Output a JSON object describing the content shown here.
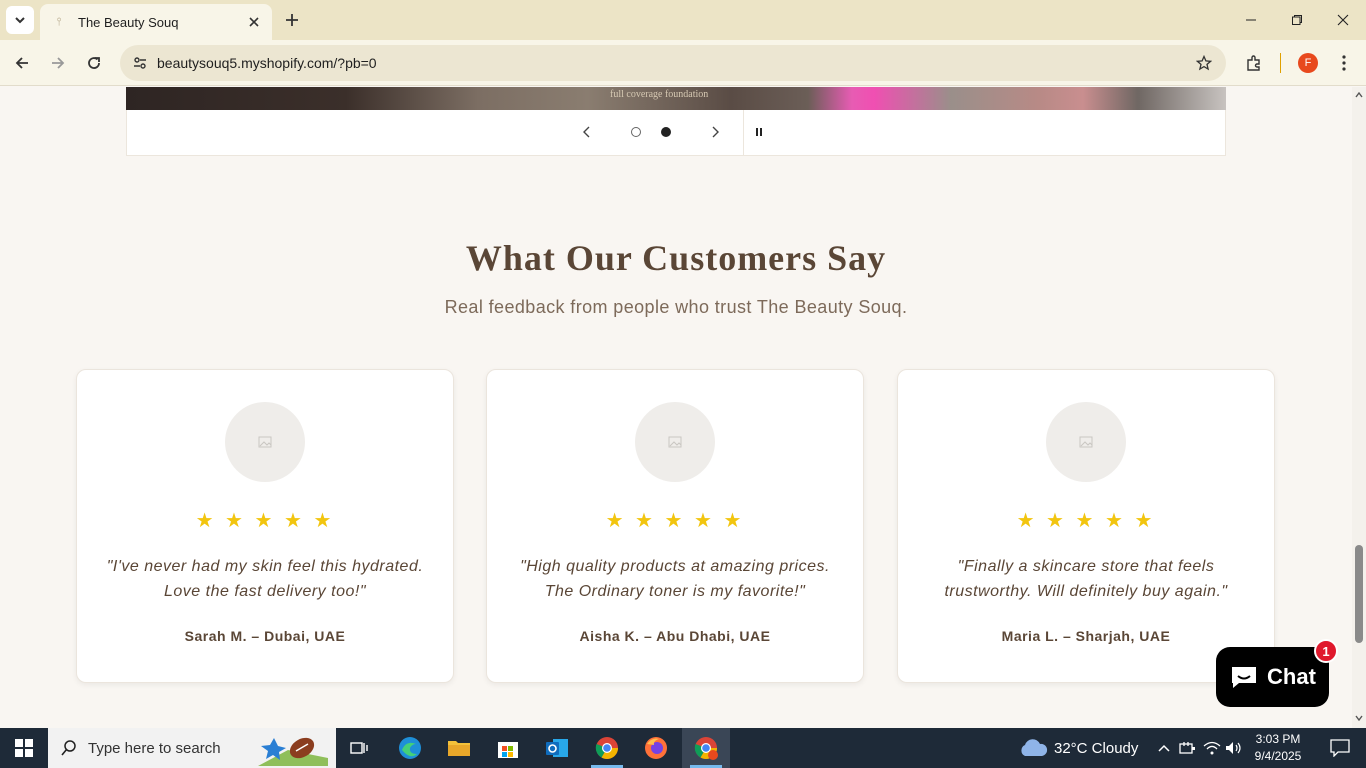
{
  "browser": {
    "tab_title": "The Beauty Souq",
    "url": "beautysouq5.myshopify.com/?pb=0",
    "profile_initial": "F",
    "icons": [
      "tab-search-icon",
      "favicon-icon",
      "close-tab-icon",
      "new-tab-icon",
      "minimize-icon",
      "restore-icon",
      "window-close-icon",
      "back-icon",
      "forward-icon",
      "reload-icon",
      "site-info-icon",
      "bookmark-star-icon",
      "extensions-icon",
      "menu-kebab-icon"
    ]
  },
  "slideshow": {
    "caption": "full coverage foundation",
    "dots": [
      "slide-1",
      "slide-2"
    ],
    "active_slide": 2
  },
  "testimonials": {
    "title": "What Our Customers Say",
    "subtitle": "Real feedback from people who trust The Beauty Souq.",
    "star_color": "#f2c50f",
    "items": [
      {
        "stars": "★ ★ ★ ★ ★",
        "rating": 5,
        "quote": "\"I've never had my skin feel this hydrated. Love the fast delivery too!\"",
        "author": "Sarah M. – Dubai, UAE"
      },
      {
        "stars": "★ ★ ★ ★ ★",
        "rating": 5,
        "quote": "\"High quality products at amazing prices. The Ordinary toner is my favorite!\"",
        "author": "Aisha K. – Abu Dhabi, UAE"
      },
      {
        "stars": "★ ★ ★ ★ ★",
        "rating": 5,
        "quote": "\"Finally a skincare store that feels trustworthy. Will definitely buy again.\"",
        "author": "Maria L. – Sharjah, UAE"
      }
    ]
  },
  "chat": {
    "label": "Chat",
    "badge": "1"
  },
  "taskbar": {
    "search_placeholder": "Type here to search",
    "weather": "32°C  Cloudy",
    "time": "3:03 PM",
    "date": "9/4/2025",
    "apps": [
      "task-view-icon",
      "edge-icon",
      "file-explorer-icon",
      "store-icon",
      "outlook-icon",
      "chrome-icon",
      "firefox-icon",
      "chrome-profile-icon"
    ]
  }
}
